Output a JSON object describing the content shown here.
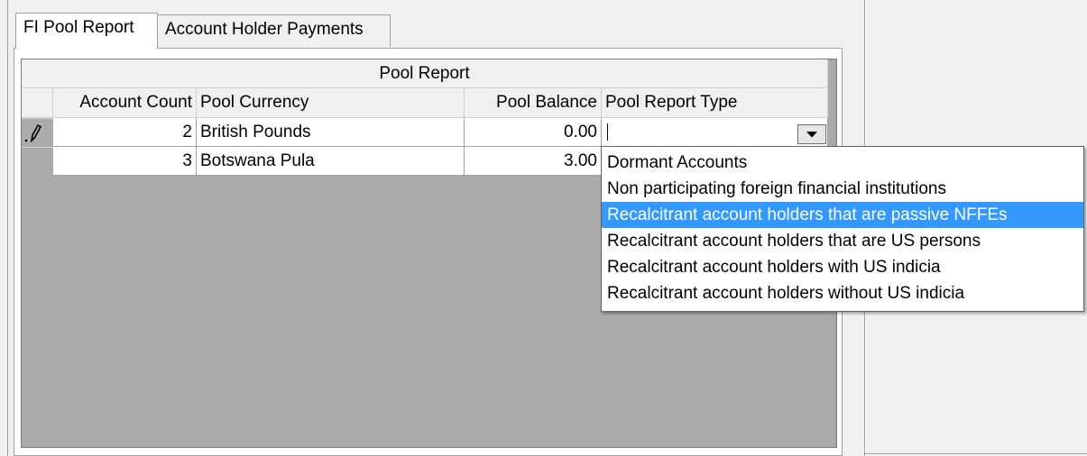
{
  "tabs": [
    {
      "label": "FI Pool Report",
      "active": true
    },
    {
      "label": "Account Holder Payments",
      "active": false
    }
  ],
  "grid": {
    "band_title": "Pool Report",
    "columns": [
      "Account Count",
      "Pool Currency",
      "Pool Balance",
      "Pool Report Type"
    ],
    "rows": [
      {
        "editing": true,
        "count": "2",
        "currency": "British Pounds",
        "balance": "0.00",
        "type": ""
      },
      {
        "editing": false,
        "count": "3",
        "currency": "Botswana Pula",
        "balance": "3.00",
        "type": "Dormant Accounts"
      }
    ],
    "edit_icon": "pencil-icon"
  },
  "dropdown": {
    "icon": "chevron-down-icon",
    "selected_index": 2,
    "options": [
      "Dormant Accounts",
      "Non participating foreign financial institutions",
      "Recalcitrant account holders that are passive NFFEs",
      "Recalcitrant account holders that are US persons",
      "Recalcitrant account holders with US indicia",
      "Recalcitrant account holders without US indicia"
    ]
  },
  "colors": {
    "selection": "#3399ff",
    "grid_background": "#ababab"
  }
}
